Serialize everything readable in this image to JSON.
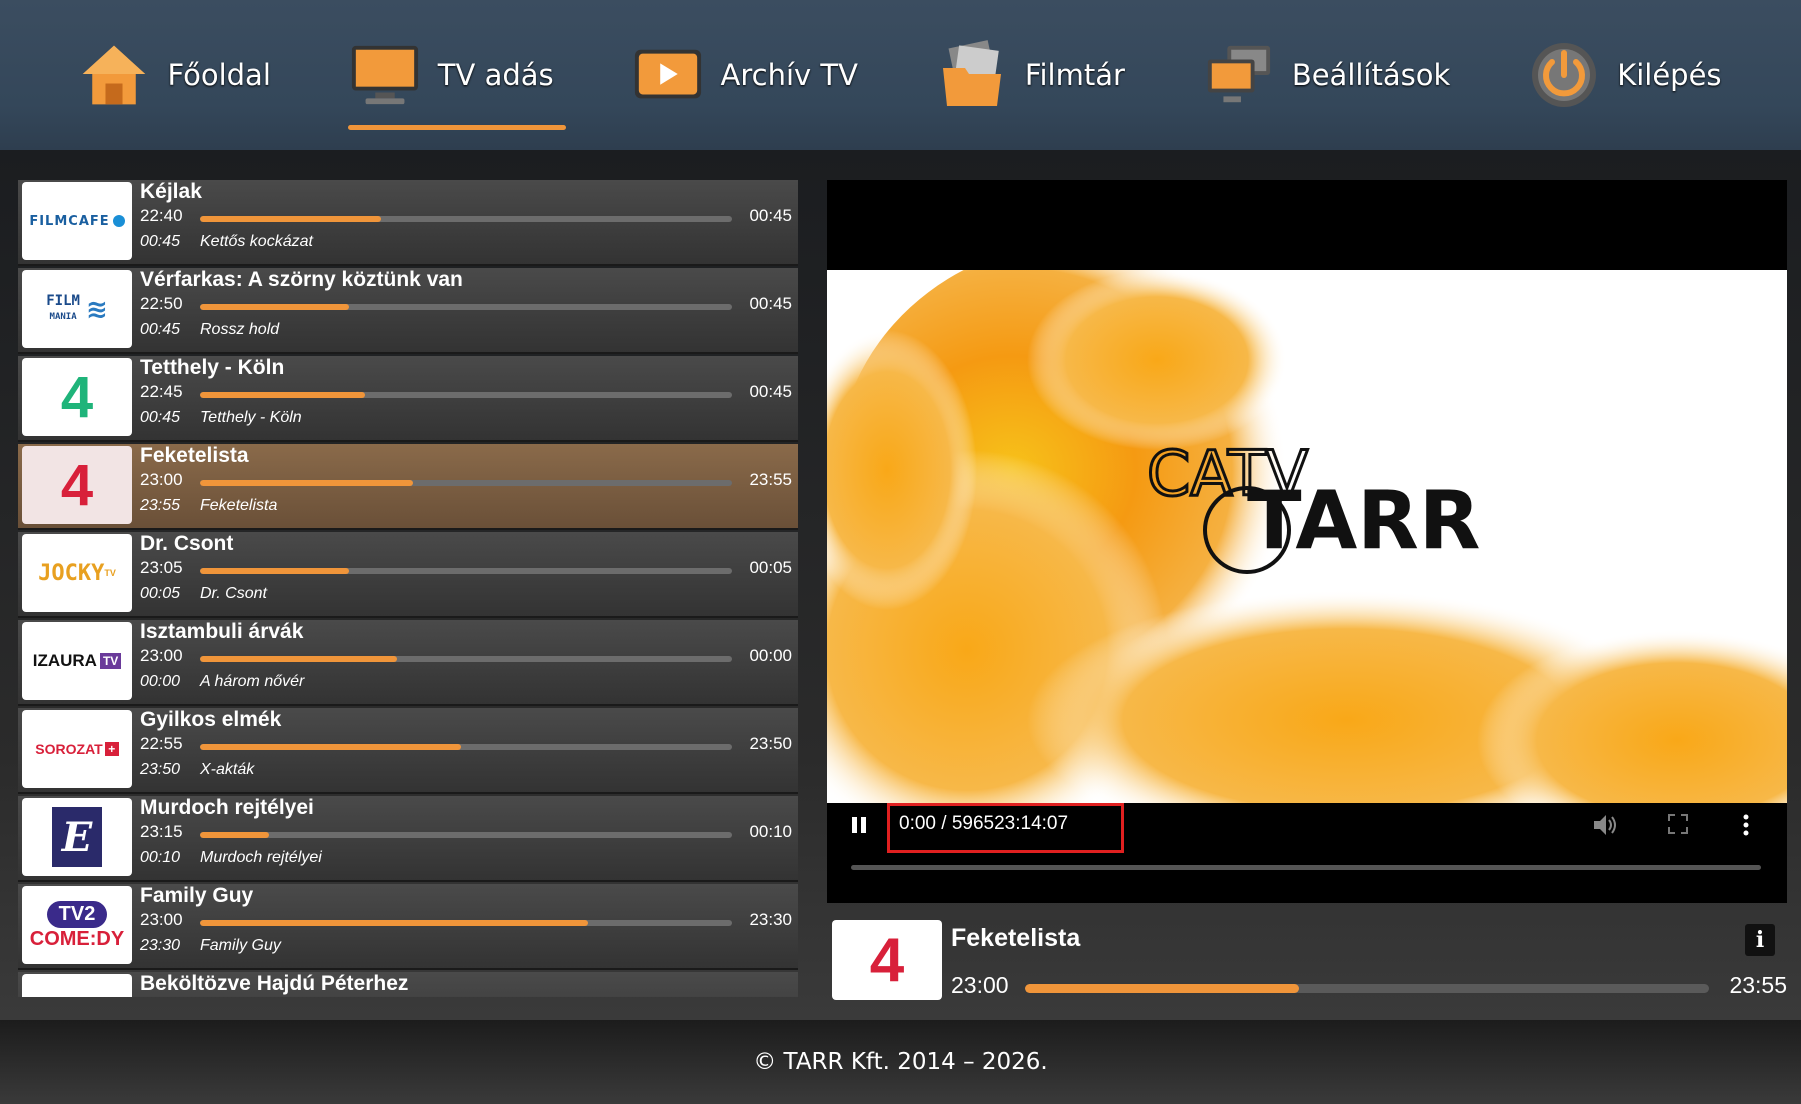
{
  "nav": {
    "items": [
      {
        "label": "Főoldal",
        "icon": "home-icon"
      },
      {
        "label": "TV adás",
        "icon": "tv-icon",
        "active": true
      },
      {
        "label": "Archív TV",
        "icon": "play-archive-icon"
      },
      {
        "label": "Filmtár",
        "icon": "film-folder-icon"
      },
      {
        "label": "Beállítások",
        "icon": "settings-monitor-icon"
      },
      {
        "label": "Kilépés",
        "icon": "power-icon"
      }
    ]
  },
  "channels": [
    {
      "logo": "FILMCAFE",
      "title": "Kéjlak",
      "start": "22:40",
      "end": "00:45",
      "progress": 0.34,
      "next_time": "00:45",
      "next_title": "Kettős kockázat"
    },
    {
      "logo": "FILM MANIA",
      "title": "Vérfarkas: A szörny köztünk van",
      "start": "22:50",
      "end": "00:45",
      "progress": 0.28,
      "next_time": "00:45",
      "next_title": "Rossz hold"
    },
    {
      "logo": "4 GALAXY",
      "title": "Tetthely - Köln",
      "start": "22:45",
      "end": "00:45",
      "progress": 0.31,
      "next_time": "00:45",
      "next_title": "Tetthely - Köln"
    },
    {
      "logo": "4 TV",
      "title": "Feketelista",
      "start": "23:00",
      "end": "23:55",
      "progress": 0.4,
      "next_time": "23:55",
      "next_title": "Feketelista",
      "active": true
    },
    {
      "logo": "JOCKY TV",
      "title": "Dr. Csont",
      "start": "23:05",
      "end": "00:05",
      "progress": 0.28,
      "next_time": "00:05",
      "next_title": "Dr. Csont"
    },
    {
      "logo": "IZAURA TV",
      "title": "Isztambuli árvák",
      "start": "23:00",
      "end": "00:00",
      "progress": 0.37,
      "next_time": "00:00",
      "next_title": "A három nővér"
    },
    {
      "logo": "SOROZAT+",
      "title": "Gyilkos elmék",
      "start": "22:55",
      "end": "23:50",
      "progress": 0.49,
      "next_time": "23:50",
      "next_title": "X-akták"
    },
    {
      "logo": "E",
      "title": "Murdoch rejtélyei",
      "start": "23:15",
      "end": "00:10",
      "progress": 0.13,
      "next_time": "00:10",
      "next_title": "Murdoch rejtélyei"
    },
    {
      "logo": "TV2 COMEDY",
      "title": "Family Guy",
      "start": "23:00",
      "end": "23:30",
      "progress": 0.73,
      "next_time": "23:30",
      "next_title": "Family Guy"
    },
    {
      "logo": "",
      "title": "Beköltözve Hajdú Péterhez",
      "start": "",
      "end": "",
      "progress": 0,
      "next_time": "",
      "next_title": ""
    }
  ],
  "player": {
    "time_display": "0:00 / 596523:14:07",
    "video_logo": "CATV TARR"
  },
  "now_playing": {
    "title": "Feketelista",
    "start": "23:00",
    "end": "23:55",
    "progress": 0.4,
    "info_label": "i"
  },
  "footer": {
    "text": "© TARR Kft. 2014 – 2026."
  },
  "colors": {
    "accent": "#f0953a",
    "highlight_box": "#e02020"
  }
}
